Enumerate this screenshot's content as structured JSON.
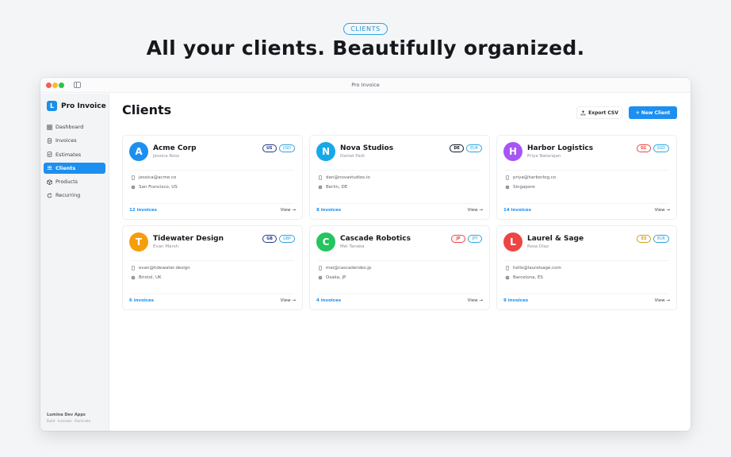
{
  "hero": {
    "pill": "CLIENTS",
    "headline": "All your clients. Beautifully organized."
  },
  "window": {
    "title": "Pro Invoice"
  },
  "sidebar": {
    "app_name": "Pro Invoice",
    "logo_letter": "L",
    "items": [
      {
        "label": "Dashboard",
        "icon": "grid-icon",
        "active": false
      },
      {
        "label": "Invoices",
        "icon": "document-icon",
        "active": false
      },
      {
        "label": "Estimates",
        "icon": "checklist-icon",
        "active": false
      },
      {
        "label": "Clients",
        "icon": "people-icon",
        "active": true
      },
      {
        "label": "Products",
        "icon": "box-icon",
        "active": false
      },
      {
        "label": "Recurring",
        "icon": "refresh-icon",
        "active": false
      }
    ],
    "footer_title": "Lumina Dev Apps",
    "footer_sub": "Build · Innovate · Illuminate"
  },
  "main": {
    "title": "Clients",
    "export_label": "Export CSV",
    "new_label": "+ New Client",
    "view_label": "View →"
  },
  "colors": {
    "accent": "#1d8ff0",
    "avatar_blue": "#1d8ff0",
    "avatar_cyan": "#16a8e8",
    "avatar_purple": "#a855f7",
    "avatar_orange": "#f59e0b",
    "avatar_green": "#22c55e",
    "avatar_red": "#ef4444"
  },
  "clients": [
    {
      "initial": "A",
      "name": "Acme Corp",
      "contact": "Jessica Ross",
      "country": "US",
      "country_color": "#1e3a8a",
      "currency": "USD",
      "email": "jessica@acme.co",
      "location": "San Francisco, US",
      "invoices": "12 invoices",
      "avatar_color": "#1d8ff0"
    },
    {
      "initial": "N",
      "name": "Nova Studios",
      "contact": "Daniel Park",
      "country": "DE",
      "country_color": "#111827",
      "currency": "EUR",
      "email": "dan@novastudios.io",
      "location": "Berlin, DE",
      "invoices": "8 invoices",
      "avatar_color": "#16a8e8"
    },
    {
      "initial": "H",
      "name": "Harbor Logistics",
      "contact": "Priya Natarajan",
      "country": "SG",
      "country_color": "#ef4444",
      "currency": "SGD",
      "email": "priya@harborlog.co",
      "location": "Singapore",
      "invoices": "14 invoices",
      "avatar_color": "#a855f7"
    },
    {
      "initial": "T",
      "name": "Tidewater Design",
      "contact": "Evan Marsh",
      "country": "GB",
      "country_color": "#1e3a8a",
      "currency": "GBP",
      "email": "evan@tidewater.design",
      "location": "Bristol, UK",
      "invoices": "6 invoices",
      "avatar_color": "#f59e0b"
    },
    {
      "initial": "C",
      "name": "Cascade Robotics",
      "contact": "Mei Tanaka",
      "country": "JP",
      "country_color": "#ef4444",
      "currency": "JPY",
      "email": "mei@cascaderobo.jp",
      "location": "Osaka, JP",
      "invoices": "4 invoices",
      "avatar_color": "#22c55e"
    },
    {
      "initial": "L",
      "name": "Laurel & Sage",
      "contact": "Rosa Díaz",
      "country": "ES",
      "country_color": "#d4a017",
      "currency": "EUR",
      "email": "hello@laurelsage.com",
      "location": "Barcelona, ES",
      "invoices": "9 invoices",
      "avatar_color": "#ef4444"
    }
  ]
}
